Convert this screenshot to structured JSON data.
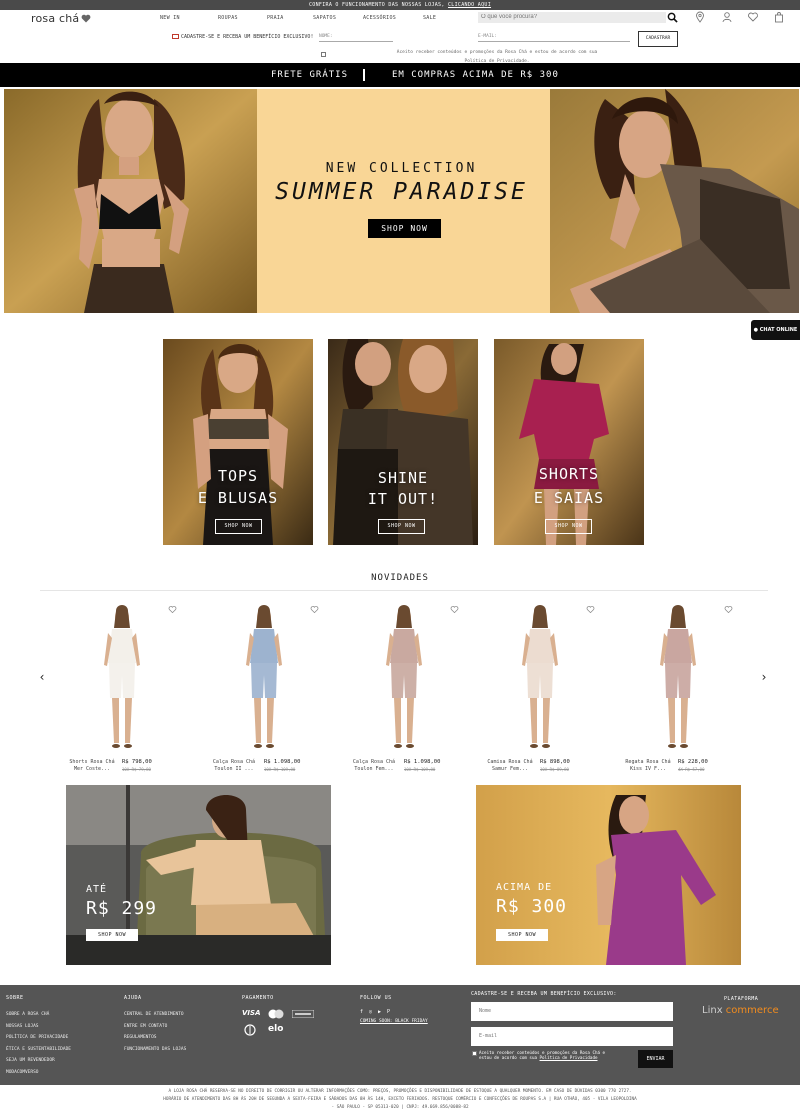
{
  "topbar": {
    "text": "CONFIRA O FUNCIONAMENTO DAS NOSSAS LOJAS, ",
    "link": "CLICANDO AQUI"
  },
  "header": {
    "logo": "rosa chá",
    "nav": [
      "NEW IN",
      "ROUPAS",
      "PRAIA",
      "SAPATOS",
      "ACESSÓRIOS",
      "SALE"
    ],
    "search_placeholder": "O que você procura?",
    "signup_text": "CADASTRE-SE E RECEBA UM BENEFÍCIO EXCLUSIVO!",
    "name_placeholder": "NOME",
    "email_placeholder": "E-MAIL",
    "consent_text": "Aceito receber conteúdos e promoções da Rosa Chá e estou de acordo com sua",
    "consent_link": "Política de Privacidade.",
    "cadastrar": "CADASTRAR"
  },
  "frete": {
    "left": "FRETE GRÁTIS",
    "right": "EM COMPRAS ACIMA DE R$ 300"
  },
  "hero": {
    "line1": "NEW COLLECTION",
    "line2": "SUMMER PARADISE",
    "button": "SHOP NOW"
  },
  "chat": "CHAT ONLINE",
  "categories": [
    {
      "title1": "TOPS",
      "title2": "E BLUSAS",
      "button": "SHOP NOW"
    },
    {
      "title1": "SHINE",
      "title2": "IT OUT!",
      "button": "SHOP NOW"
    },
    {
      "title1": "SHORTS",
      "title2": "E SAIAS",
      "button": "SHOP NOW"
    }
  ],
  "novidades": {
    "title": "NOVIDADES",
    "products": [
      {
        "name": "Shorts Rosa Chá Mer Coste...",
        "price": "R$ 798,00",
        "old": "10X R$ 79,80",
        "color": "#f3f0ea"
      },
      {
        "name": "Calça Rosa Chá Toulon II ...",
        "price": "R$ 1.098,00",
        "old": "10X R$ 109,80",
        "color": "#9db3cf"
      },
      {
        "name": "Calça Rosa Chá Toulon Fem...",
        "price": "R$ 1.098,00",
        "old": "10X R$ 109,80",
        "color": "#c9a9a0"
      },
      {
        "name": "Camisa Rosa Chá Samur Fem...",
        "price": "R$ 898,00",
        "old": "10X R$ 89,80",
        "color": "#ecdcd0"
      },
      {
        "name": "Regata Rosa Chá Kiss IV F...",
        "price": "R$ 228,00",
        "old": "4X R$ 57,00",
        "color": "#c9a6a0"
      }
    ]
  },
  "promos": [
    {
      "line1": "ATÉ",
      "line2": "R$ 299",
      "button": "SHOP NOW"
    },
    {
      "line1": "ACIMA DE",
      "line2": "R$ 300",
      "button": "SHOP NOW"
    }
  ],
  "footer": {
    "sobre": {
      "title": "SOBRE",
      "items": [
        "SOBRE A ROSA CHÁ",
        "NOSSAS LOJAS",
        "POLÍTICA DE PRIVACIDADE",
        "ÉTICA E SUSTENTABILIDADE",
        "SEJA UM REVENDEDOR",
        "MODACOMVERSO"
      ]
    },
    "ajuda": {
      "title": "AJUDA",
      "items": [
        "CENTRAL DE ATENDIMENTO",
        "ENTRE EM CONTATO",
        "REGULAMENTOS",
        "FUNCIONAMENTO DAS LOJAS"
      ]
    },
    "pagamento": {
      "title": "PAGAMENTO",
      "visa": "VISA",
      "elo": "elo"
    },
    "follow": {
      "title": "FOLLOW US",
      "link": "COMING SOON: BLACK FRIDAY"
    },
    "newsletter": {
      "title": "CADASTRE-SE E RECEBA UM BENEFÍCIO EXCLUSIVO:",
      "name": "Nome",
      "email": "E-mail",
      "consent": "Aceito receber conteúdos e promoções da Rosa Chá e estou de acordo com sua ",
      "consent_link": "Política de Privacidade",
      "button": "ENVIAR"
    },
    "plataforma": {
      "title": "PLATAFORMA",
      "linx": "Linx ",
      "commerce": "commerce"
    }
  },
  "bottom": {
    "line1": "A LOJA ROSA CHÁ RESERVA-SE NO DIREITO DE CORRIGIR OU ALTERAR INFORMAÇÕES COMO: PREÇOS, PROMOÇÕES E DISPONIBILIDADE DE ESTOQUE A QUALQUER MOMENTO. EM CASO DE DÚVIDAS 0300 770 2727.",
    "line2": "HORÁRIO DE ATENDIMENTO DAS 8H ÀS 20H DE SEGUNDA A SEXTA-FEIRA E SÁBADOS DAS 8H ÀS 14H, EXCETO FERIADOS. RESTOQUE COMÉRCIO E CONFECÇÕES DE ROUPAS S.A | RUA OTHÃO, 405 - VILA LEOPOLDINA",
    "line3": "- SÃO PAULO - SP 05313-020 | CNPJ: 49.669.856/0088-82"
  },
  "colors": {
    "black": "#000000",
    "hero_bg": "#f9d696",
    "footer_bg": "#555555",
    "commerce_orange": "#f28c1e"
  }
}
